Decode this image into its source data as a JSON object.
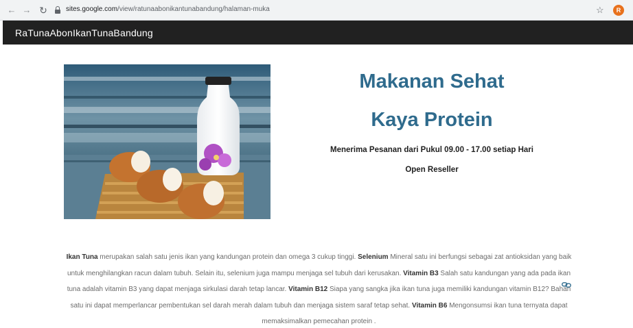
{
  "browser": {
    "url_host": "sites.google.com",
    "url_path": "/view/ratunaabonikantunabandung/halaman-muka",
    "profile_initial": "R",
    "colors": {
      "profile": "#e8711c"
    },
    "icons": [
      "back-arrow-icon",
      "forward-arrow-icon",
      "reload-icon",
      "lock-icon",
      "bookmark-star-icon",
      "profile-avatar-icon"
    ]
  },
  "site": {
    "title": "RaTunaAbonIkanTunaBandung"
  },
  "hero": {
    "headline_line1": "Makanan Sehat",
    "headline_line2": "Kaya Protein",
    "order_hours": "Menerima Pesanan dari Pukul 09.00 - 17.00 setiap Hari",
    "reseller": "Open Reseller",
    "colors": {
      "headline": "#2f6b8d"
    }
  },
  "content": {
    "p_tuna_term": "Ikan Tuna",
    "p_tuna_text": " merupakan salah satu jenis ikan yang kandungan protein dan omega 3 cukup tinggi.  ",
    "p_selenium_term": "Selenium",
    "p_selenium_text": " Mineral satu ini berfungsi sebagai zat antioksidan yang baik untuk menghilangkan racun dalam tubuh. Selain itu, selenium juga mampu menjaga sel tubuh dari kerusakan.  ",
    "p_b3_term": "Vitamin B3",
    "p_b3_text": " Salah satu kandungan yang ada pada ikan tuna adalah vitamin B3 yang dapat menjaga sirkulasi darah tetap lancar. ",
    "p_b12_term": "Vitamin B12",
    "p_b12_text": " Siapa yang sangka jika ikan tuna juga memiliki kandungan vitamin B12? Bahan satu ini dapat memperlancar pembentukan sel darah merah dalam tubuh dan menjaga sistem saraf tetap sehat. ",
    "p_b6_term": "Vitamin B6",
    "p_b6_text": " Mengonsumsi ikan tuna ternyata dapat memaksimalkan pemecahan protein ."
  }
}
